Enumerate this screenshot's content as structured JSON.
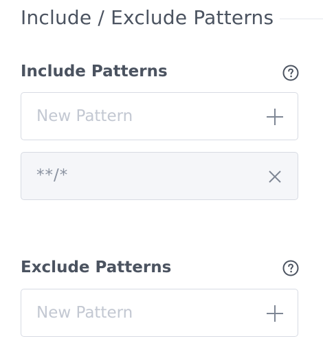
{
  "page": {
    "title": "Include / Exclude Patterns"
  },
  "include": {
    "heading": "Include Patterns",
    "new_placeholder": "New Pattern",
    "patterns": [
      "**/*"
    ]
  },
  "exclude": {
    "heading": "Exclude Patterns",
    "new_placeholder": "New Pattern",
    "patterns": []
  },
  "icons": {
    "help": "help-circle-icon",
    "add": "plus-icon",
    "remove": "close-icon"
  },
  "colors": {
    "text": "#4b5360",
    "muted": "#c3c8d2",
    "border": "#d7dbe3",
    "filled_bg": "#f5f6f9",
    "icon": "#7e8694"
  }
}
